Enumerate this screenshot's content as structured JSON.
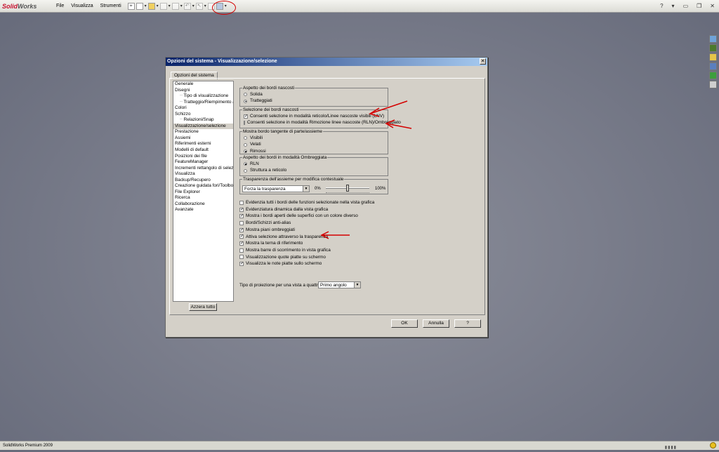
{
  "app": {
    "logo_solid": "Solid",
    "logo_works": "Works",
    "menu": [
      "File",
      "Visualizza",
      "Strumenti"
    ],
    "help_mark": "?",
    "status_text": "SolidWorks Premium 2009"
  },
  "dialog": {
    "title": "Opzioni del sistema - Visualizzazione/selezione",
    "close_glyph": "✕",
    "tab": "Opzioni del sistema",
    "tree": [
      {
        "label": "Generale",
        "sub": false
      },
      {
        "label": "Disegni",
        "sub": false
      },
      {
        "label": "Tipo di visualizzazione",
        "sub": true
      },
      {
        "label": "Tratteggio/Riempimento aree",
        "sub": true
      },
      {
        "label": "Colori",
        "sub": false
      },
      {
        "label": "Schizzo",
        "sub": false
      },
      {
        "label": "Relazioni/Snap",
        "sub": true
      },
      {
        "label": "Visualizzazione/selezione",
        "sub": false,
        "selected": true
      },
      {
        "label": "Prestazione",
        "sub": false
      },
      {
        "label": "Assiemi",
        "sub": false
      },
      {
        "label": "Riferimenti esterni",
        "sub": false
      },
      {
        "label": "Modelli di default",
        "sub": false
      },
      {
        "label": "Posizioni dei file",
        "sub": false
      },
      {
        "label": "FeatureManager",
        "sub": false
      },
      {
        "label": "Incrementi rettangolo di selezione",
        "sub": false
      },
      {
        "label": "Visualizza",
        "sub": false
      },
      {
        "label": "Backup/Recupero",
        "sub": false
      },
      {
        "label": "Creazione guidata fori/Toolbox",
        "sub": false
      },
      {
        "label": "File Explorer",
        "sub": false
      },
      {
        "label": "Ricerca",
        "sub": false
      },
      {
        "label": "Collaborazione",
        "sub": false
      },
      {
        "label": "Avanzate",
        "sub": false
      }
    ],
    "reset_button": "Azzera tutto",
    "hidden_edges": {
      "title": "Aspetto dei bordi nascosti",
      "options": [
        "Solida",
        "Tratteggiati"
      ],
      "selected": 1
    },
    "hidden_selection": {
      "title": "Selezione dei bordi nascosti",
      "items": [
        {
          "label": "Consenti selezione in modalità reticolo/Linee nascoste visibili (LNV)",
          "checked": true
        },
        {
          "label": "Consenti selezione in modalità Rimozione linee nascoste (RLN)/Ombreggiato",
          "checked": false
        }
      ]
    },
    "tangent_edges": {
      "title": "Mostra bordo tangente di parte/assieme",
      "options": [
        "Visibili",
        "Velati",
        "Rimossi"
      ],
      "selected": 2
    },
    "shaded_edges": {
      "title": "Aspetto dei bordi in modalità Ombreggiata",
      "options": [
        "RLN",
        "Struttura a reticolo"
      ],
      "selected": 0
    },
    "transparency": {
      "title": "Trasparenza dell'assieme per modifica contestuale",
      "select_value": "Forza la trasparenza",
      "min_label": "0%",
      "max_label": "100%",
      "slider_value_percent": 50
    },
    "checks": [
      {
        "label": "Evidenzia tutti i bordi delle funzioni selezionate nella vista grafica",
        "checked": false
      },
      {
        "label": "Evidenziatura dinamica dalla vista grafica",
        "checked": true
      },
      {
        "label": "Mostra i bordi aperti delle superfici con un colore diverso",
        "checked": true
      },
      {
        "label": "Bordi/Schizzi anti-alias",
        "checked": false
      },
      {
        "label": "Mostra piani ombreggiati",
        "checked": true
      },
      {
        "label": "Attiva selezione attraverso la trasparenza",
        "checked": true
      },
      {
        "label": "Mostra la terna di riferimento",
        "checked": true
      },
      {
        "label": "Mostra barre di scorrimento in vista grafica",
        "checked": false
      },
      {
        "label": "Visualizzazione quote piatte su schermo",
        "checked": false
      },
      {
        "label": "Visualizza le note piatte sullo schermo",
        "checked": true
      }
    ],
    "projection": {
      "label": "Tipo di proiezione per una vista a quattro:",
      "value": "Primo angolo"
    },
    "buttons": {
      "ok": "OK",
      "cancel": "Annulla",
      "help": "?"
    }
  },
  "colors": {
    "annotation_red": "#d40000",
    "title_bar": "#0a246a",
    "dialog_bg": "#d4d0c8"
  }
}
